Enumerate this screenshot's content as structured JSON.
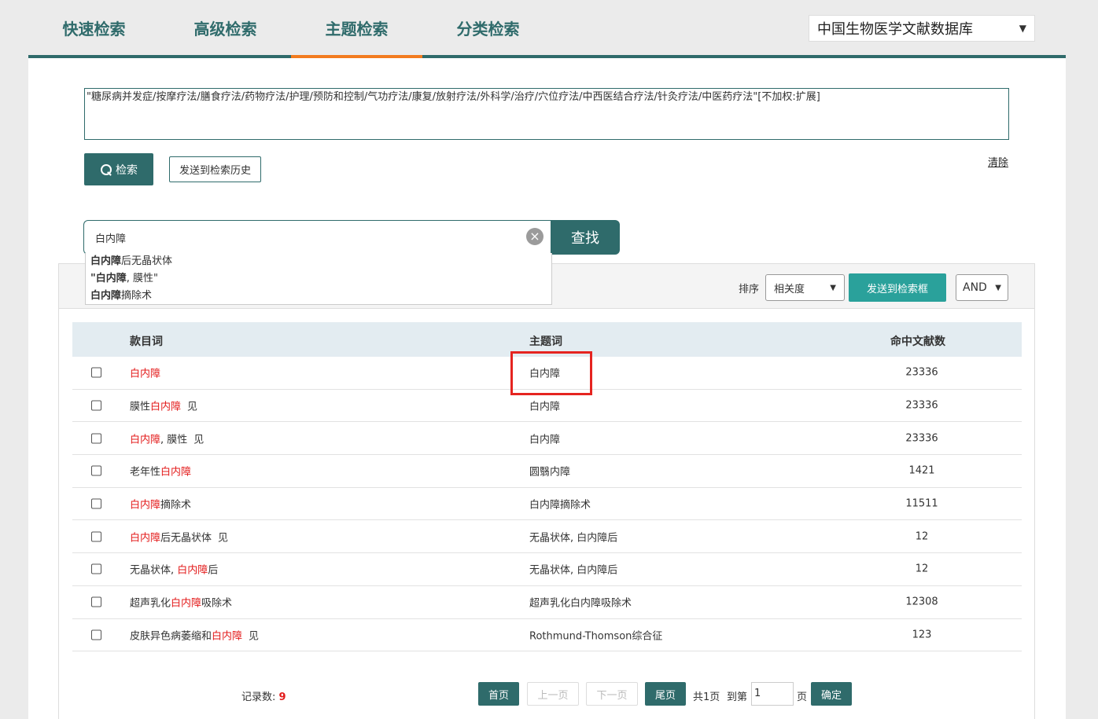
{
  "tabs": [
    {
      "label": "快速检索"
    },
    {
      "label": "高级检索"
    },
    {
      "label": "主题检索",
      "active": true
    },
    {
      "label": "分类检索"
    }
  ],
  "database": {
    "selected": "中国生物医学文献数据库"
  },
  "query": {
    "text": "\"糖尿病并发症/按摩疗法/膳食疗法/药物疗法/护理/预防和控制/气功疗法/康复/放射疗法/外科学/治疗/穴位疗法/中西医结合疗法/针灸疗法/中医药疗法\"[不加权:扩展]",
    "search_label": "检索",
    "history_label": "发送到检索历史",
    "clear_label": "清除"
  },
  "term_search": {
    "value": "白内障",
    "find_label": "查找",
    "suggestions": [
      {
        "bold": "白内障",
        "rest": "后无晶状体"
      },
      {
        "bold": "\"白内障",
        "rest": ", 膜性\""
      },
      {
        "bold": "白内障",
        "rest": "摘除术"
      }
    ]
  },
  "toolbar": {
    "sort_label": "排序",
    "sort_value": "相关度",
    "send_label": "发送到检索框",
    "operator": "AND"
  },
  "table": {
    "headers": {
      "entry": "款目词",
      "subject": "主题词",
      "count": "命中文献数"
    },
    "see_label": "见",
    "rows": [
      {
        "pre": "",
        "hl": "白内障",
        "post": "",
        "see": false,
        "subject": "白内障",
        "count": "23336"
      },
      {
        "pre": "膜性",
        "hl": "白内障",
        "post": "",
        "see": true,
        "subject": "白内障",
        "count": "23336"
      },
      {
        "pre": "",
        "hl": "白内障",
        "post": ", 膜性",
        "see": true,
        "subject": "白内障",
        "count": "23336"
      },
      {
        "pre": "老年性",
        "hl": "白内障",
        "post": "",
        "see": false,
        "subject": "圆翳内障",
        "count": "1421"
      },
      {
        "pre": "",
        "hl": "白内障",
        "post": "摘除术",
        "see": false,
        "subject": "白内障摘除术",
        "count": "11511"
      },
      {
        "pre": "",
        "hl": "白内障",
        "post": "后无晶状体",
        "see": true,
        "subject": "无晶状体, 白内障后",
        "count": "12"
      },
      {
        "pre": "无晶状体, ",
        "hl": "白内障",
        "post": "后",
        "see": false,
        "subject": "无晶状体, 白内障后",
        "count": "12"
      },
      {
        "pre": "超声乳化",
        "hl": "白内障",
        "post": "吸除术",
        "see": false,
        "subject": "超声乳化白内障吸除术",
        "count": "12308"
      },
      {
        "pre": "皮肤异色病萎缩和",
        "hl": "白内障",
        "post": "",
        "see": true,
        "subject": "Rothmund-Thomson综合征",
        "count": "123"
      }
    ]
  },
  "pager": {
    "records_label": "记录数:",
    "records": "9",
    "first": "首页",
    "prev": "上一页",
    "next": "下一页",
    "last": "尾页",
    "total": "共1页",
    "goto": "到第",
    "page_value": "1",
    "page_unit": "页",
    "confirm": "确定"
  }
}
